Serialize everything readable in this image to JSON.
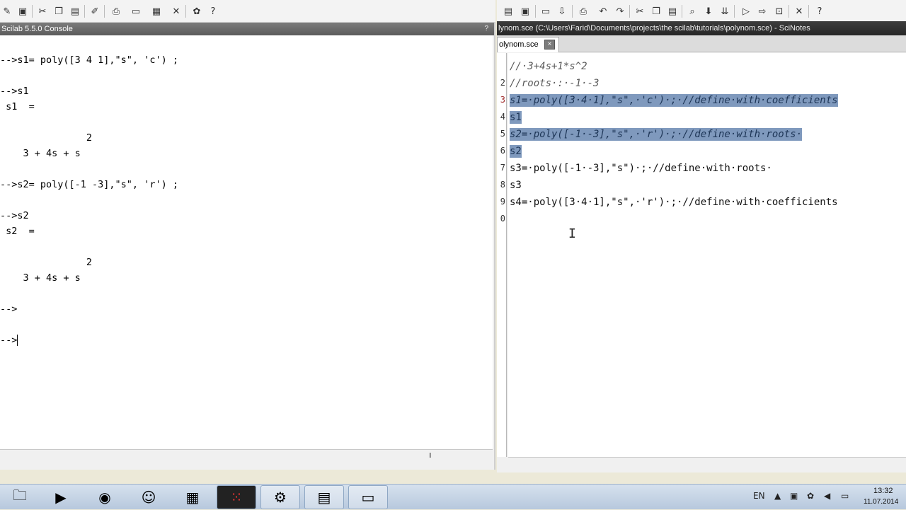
{
  "console": {
    "title": "Scilab 5.5.0 Console",
    "close_glyph": "?",
    "lines": [
      "-->s1= poly([3 4 1],\"s\", 'c') ;",
      "-->s1",
      " s1  =",
      "               2",
      "    3 + 4s + s",
      "-->s2= poly([-1 -3],\"s\", 'r') ;",
      "-->s2",
      " s2  =",
      "               2",
      "    3 + 4s + s",
      "-->",
      "-->"
    ],
    "toolbar_icons": [
      "edit-icon",
      "save-icon",
      "cut-icon",
      "copy-icon",
      "paste-icon",
      "edit-pen-icon",
      "print-icon",
      "print-setup-icon",
      "graphics-icon",
      "preferences-icon",
      "modules-icon",
      "help-icon"
    ],
    "status_mark": "ı"
  },
  "scinotes": {
    "title": "lynom.sce (C:\\Users\\Farid\\Documents\\projects\\the scilab\\tutorials\\polynom.sce) - SciNotes",
    "tab_label": "olynom.sce",
    "line_numbers": [
      "",
      "2",
      "3",
      "4",
      "5",
      "6",
      "7",
      "8",
      "9",
      "0"
    ],
    "code_lines": [
      "//·3+4s+1*s^2",
      "//roots·:·-1·-3",
      "s1=·poly([3·4·1],\"s\",·'c')·;·//define·with·coefficients",
      "s1",
      "s2=·poly([-1·-3],\"s\",·'r')·;·//define·with·roots·",
      "s2",
      "s3=·poly([-1·-3],\"s\")·;·//define·with·roots·",
      "s3",
      "s4=·poly([3·4·1],\"s\",·'r')·;·//define·with·coefficients",
      ""
    ],
    "selected_lines": [
      2,
      3,
      4,
      5
    ]
  },
  "taskbar": {
    "apps": [
      "explorer-icon",
      "media-player-icon",
      "firefox-icon",
      "network-icon",
      "calculator-icon",
      "scilab-graphics-icon",
      "scilab-console-icon",
      "scinotes-icon",
      "file-manager-icon"
    ],
    "lang": "EN",
    "time": "13:32",
    "date": "11.07.2014"
  }
}
